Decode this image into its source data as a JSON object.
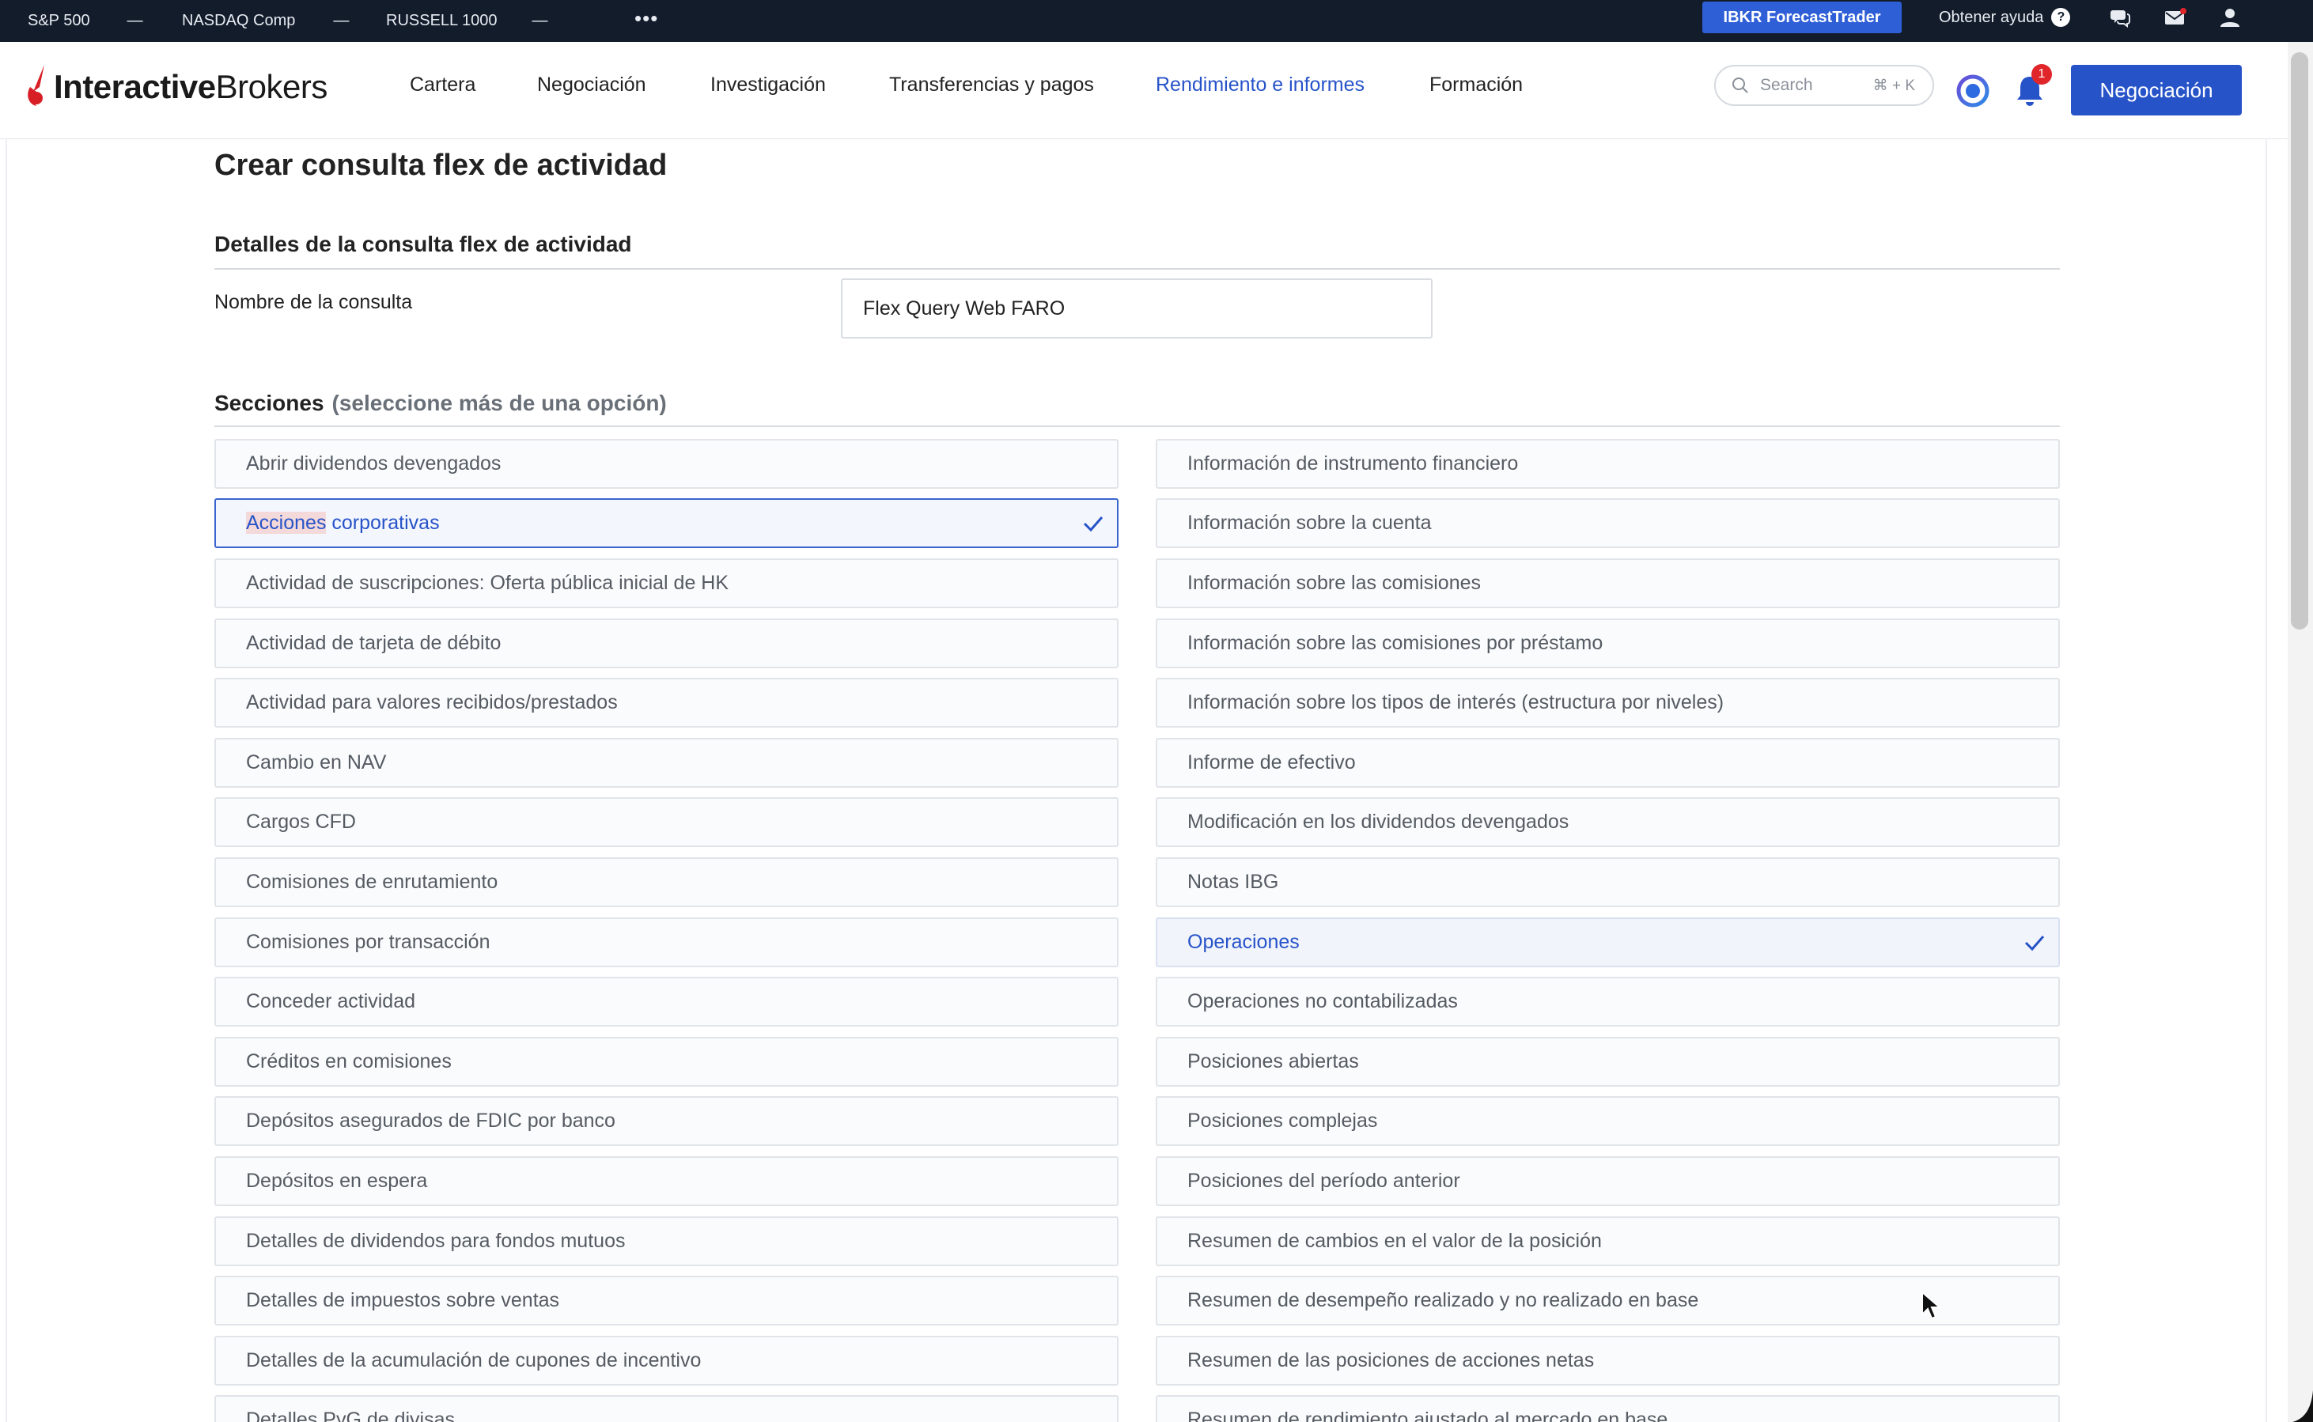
{
  "ticker": {
    "items": [
      {
        "label": "S&P 500",
        "value": "—"
      },
      {
        "label": "NASDAQ Comp",
        "value": "—"
      },
      {
        "label": "RUSSELL 1000",
        "value": "—"
      }
    ],
    "more": "•••",
    "forecast_button": "IBKR ForecastTrader",
    "help_label": "Obtener ayuda",
    "help_glyph": "?"
  },
  "header": {
    "logo_part1": "Interactive",
    "logo_part2": "Brokers",
    "nav": [
      {
        "label": "Cartera",
        "active": false
      },
      {
        "label": "Negociación",
        "active": false
      },
      {
        "label": "Investigación",
        "active": false
      },
      {
        "label": "Transferencias y pagos",
        "active": false
      },
      {
        "label": "Rendimiento e informes",
        "active": true
      },
      {
        "label": "Formación",
        "active": false
      }
    ],
    "search_placeholder": "Search",
    "search_shortcut": "⌘ + K",
    "notification_count": "1",
    "trade_button": "Negociación"
  },
  "page": {
    "title": "Crear consulta flex de actividad",
    "details_title": "Detalles de la consulta flex de actividad",
    "query_name_label": "Nombre de la consulta",
    "query_name_value": "Flex Query Web FARO",
    "sections_title": "Secciones",
    "sections_hint": "(seleccione más de una opción)"
  },
  "sections_left": [
    {
      "label": "Abrir dividendos devengados",
      "selected": false
    },
    {
      "label_highlight": "Acciones",
      "label": " corporativas",
      "selected": true
    },
    {
      "label": "Actividad de suscripciones: Oferta pública inicial de HK",
      "selected": false
    },
    {
      "label": "Actividad de tarjeta de débito",
      "selected": false
    },
    {
      "label": "Actividad para valores recibidos/prestados",
      "selected": false
    },
    {
      "label": "Cambio en NAV",
      "selected": false
    },
    {
      "label": "Cargos CFD",
      "selected": false
    },
    {
      "label": "Comisiones de enrutamiento",
      "selected": false
    },
    {
      "label": "Comisiones por transacción",
      "selected": false
    },
    {
      "label": "Conceder actividad",
      "selected": false
    },
    {
      "label": "Créditos en comisiones",
      "selected": false
    },
    {
      "label": "Depósitos asegurados de FDIC por banco",
      "selected": false
    },
    {
      "label": "Depósitos en espera",
      "selected": false
    },
    {
      "label": "Detalles de dividendos para fondos mutuos",
      "selected": false
    },
    {
      "label": "Detalles de impuestos sobre ventas",
      "selected": false
    },
    {
      "label": "Detalles de la acumulación de cupones de incentivo",
      "selected": false
    },
    {
      "label": "Detalles PyG de divisas",
      "selected": false
    }
  ],
  "sections_right": [
    {
      "label": "Información de instrumento financiero",
      "selected": false
    },
    {
      "label": "Información sobre la cuenta",
      "selected": false
    },
    {
      "label": "Información sobre las comisiones",
      "selected": false
    },
    {
      "label": "Información sobre las comisiones por préstamo",
      "selected": false
    },
    {
      "label": "Información sobre los tipos de interés (estructura por niveles)",
      "selected": false
    },
    {
      "label": "Informe de efectivo",
      "selected": false
    },
    {
      "label": "Modificación en los dividendos devengados",
      "selected": false
    },
    {
      "label": "Notas IBG",
      "selected": false
    },
    {
      "label": "Operaciones",
      "selected": true
    },
    {
      "label": "Operaciones no contabilizadas",
      "selected": false
    },
    {
      "label": "Posiciones abiertas",
      "selected": false
    },
    {
      "label": "Posiciones complejas",
      "selected": false
    },
    {
      "label": "Posiciones del período anterior",
      "selected": false
    },
    {
      "label": "Resumen de cambios en el valor de la posición",
      "selected": false
    },
    {
      "label": "Resumen de desempeño realizado y no realizado en base",
      "selected": false
    },
    {
      "label": "Resumen de las posiciones de acciones netas",
      "selected": false
    },
    {
      "label": "Resumen de rendimiento ajustado al mercado en base",
      "selected": false
    }
  ],
  "colors": {
    "accent": "#2753c9",
    "topbar": "#121c2b",
    "forecast": "#2f5fd7",
    "badge": "#e0262a",
    "logo_red": "#d81f26"
  }
}
